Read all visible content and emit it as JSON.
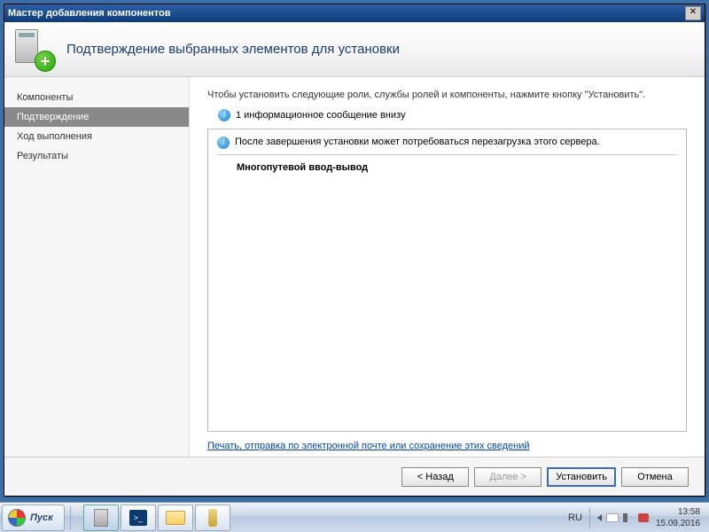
{
  "titlebar": {
    "title": "Мастер добавления компонентов"
  },
  "header": {
    "title": "Подтверждение выбранных элементов для установки"
  },
  "sidebar": {
    "items": [
      {
        "label": "Компоненты"
      },
      {
        "label": "Подтверждение"
      },
      {
        "label": "Ход выполнения"
      },
      {
        "label": "Результаты"
      }
    ]
  },
  "content": {
    "instruction": "Чтобы установить следующие роли, службы ролей и компоненты, нажмите кнопку \"Установить\".",
    "info_count": "1 информационное сообщение внизу",
    "warning": "После завершения установки может потребоваться перезагрузка этого сервера.",
    "component": "Многопутевой ввод-вывод",
    "link": "Печать, отправка по электронной почте или сохранение этих сведений"
  },
  "footer": {
    "back": "< Назад",
    "next": "Далее >",
    "install": "Установить",
    "cancel": "Отмена"
  },
  "taskbar": {
    "start": "Пуск",
    "lang": "RU",
    "time": "13:58",
    "date": "15.09.2016"
  }
}
